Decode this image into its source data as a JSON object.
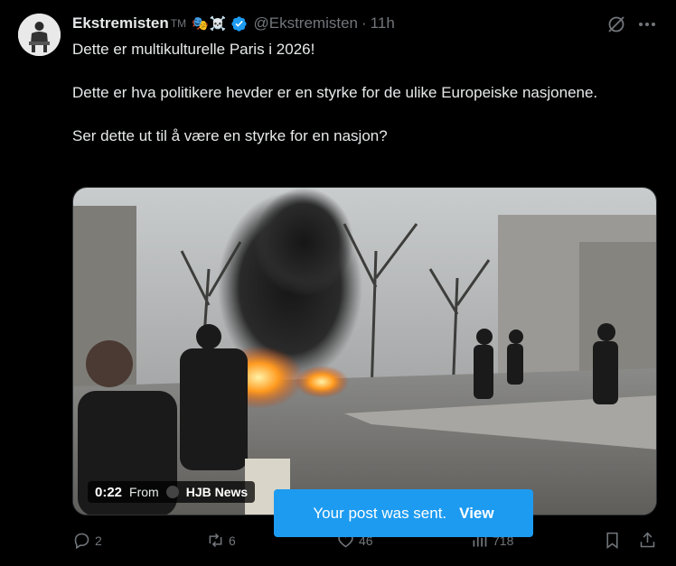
{
  "author": {
    "display_name": "Ekstremisten",
    "tm": "TM",
    "emoji": [
      "🎭",
      "☠️"
    ],
    "handle": "@Ekstremisten",
    "separator": "·",
    "time": "11h"
  },
  "post": {
    "lines": [
      "Dette er multikulturelle Paris i 2026!",
      "Dette er hva politikere hevder er en styrke for de ulike Europeiske nasjonene.",
      "Ser dette ut til å være en styrke for en nasjon?"
    ]
  },
  "video": {
    "duration": "0:22",
    "from_label": "From",
    "source": "HJB News"
  },
  "actions": {
    "replies": "2",
    "reposts": "6",
    "likes": "46",
    "views": "718"
  },
  "toast": {
    "message": "Your post was sent.",
    "view_label": "View"
  },
  "colors": {
    "background": "#000000",
    "text": "#e7e9ea",
    "muted": "#71767b",
    "accent": "#1d9bf0"
  },
  "icons": [
    "grok-icon",
    "more-icon",
    "verified-badge-icon",
    "reply-icon",
    "repost-icon",
    "like-icon",
    "views-icon",
    "bookmark-icon",
    "share-icon"
  ]
}
